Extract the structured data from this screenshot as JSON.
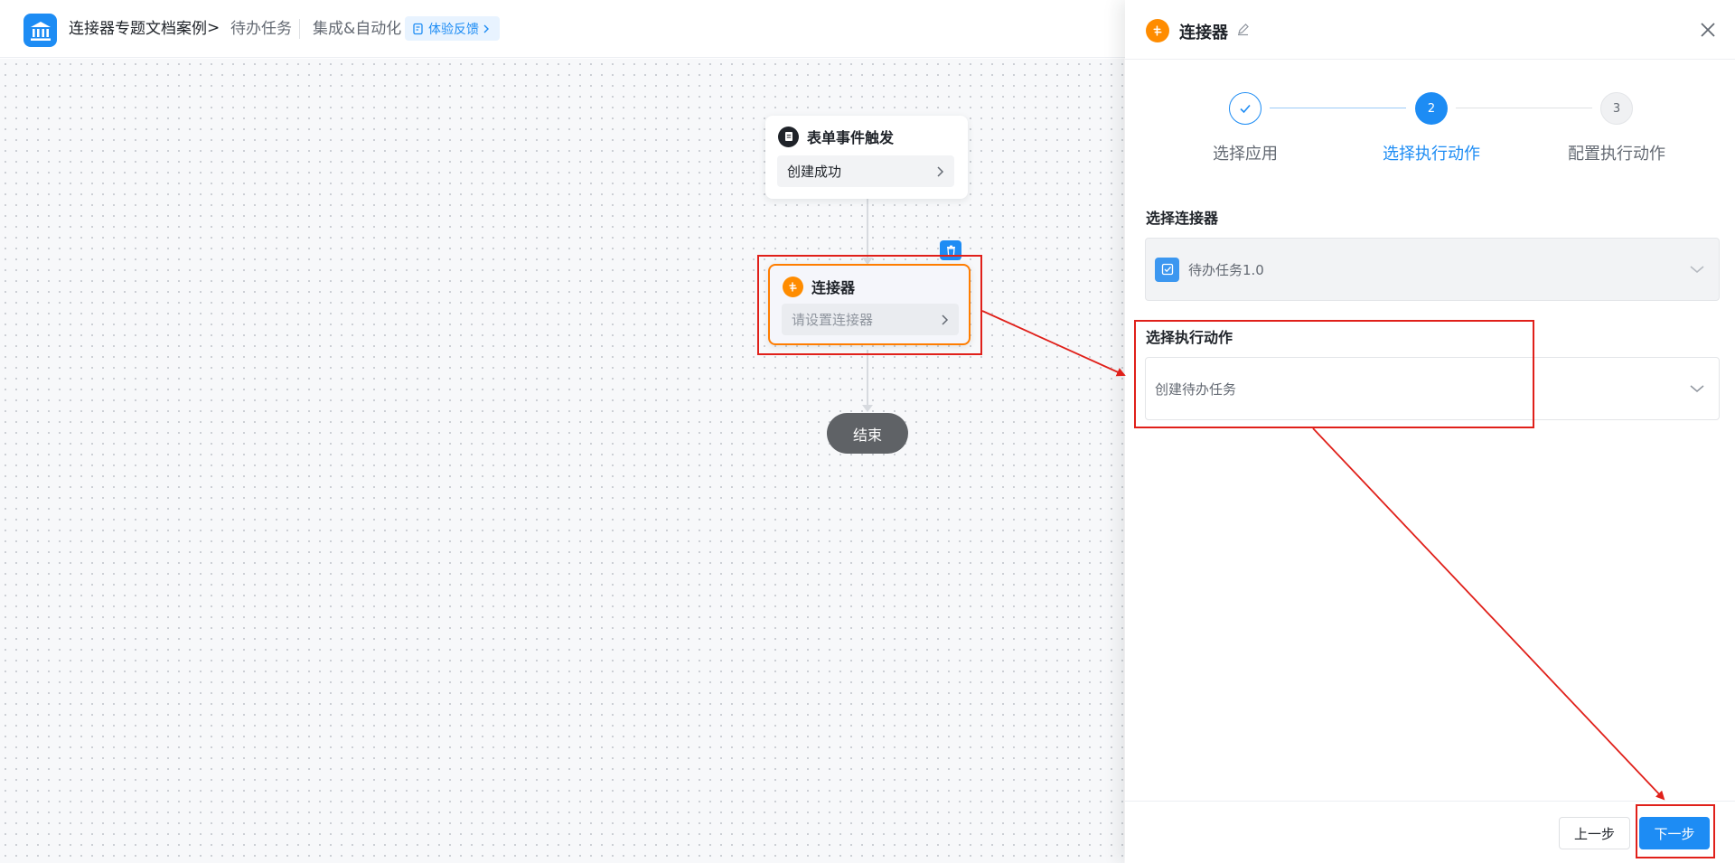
{
  "header": {
    "app_name": "连接器专题文档案例",
    "breadcrumb_separator": ">",
    "page_name": "待办任务",
    "section_name": "集成&自动化",
    "feedback_label": "体验反馈"
  },
  "canvas": {
    "trigger_node": {
      "title": "表单事件触发",
      "value": "创建成功"
    },
    "connector_node": {
      "title": "连接器",
      "placeholder": "请设置连接器"
    },
    "end_node": {
      "label": "结束"
    }
  },
  "panel": {
    "title": "连接器",
    "steps": [
      {
        "number": "1",
        "label": "选择应用",
        "state": "done"
      },
      {
        "number": "2",
        "label": "选择执行动作",
        "state": "active"
      },
      {
        "number": "3",
        "label": "配置执行动作",
        "state": "pending"
      }
    ],
    "connector_field": {
      "label": "选择连接器",
      "value": "待办任务1.0"
    },
    "action_field": {
      "label": "选择执行动作",
      "value": "创建待办任务"
    },
    "buttons": {
      "prev": "上一步",
      "next": "下一步"
    }
  },
  "colors": {
    "primary": "#1d8cf4",
    "connector_orange": "#ff8c00",
    "annotation_red": "#e0201a",
    "end_node_gray": "#5f6266"
  },
  "icons": {
    "app_logo": "bank-icon",
    "trigger": "document-icon",
    "connector": "connector-icon",
    "delete": "trash-icon",
    "edit": "pencil-icon",
    "close": "close-icon",
    "check": "check-icon",
    "select_badge": "checkbox-icon",
    "dropdown": "chevron-down-icon"
  }
}
